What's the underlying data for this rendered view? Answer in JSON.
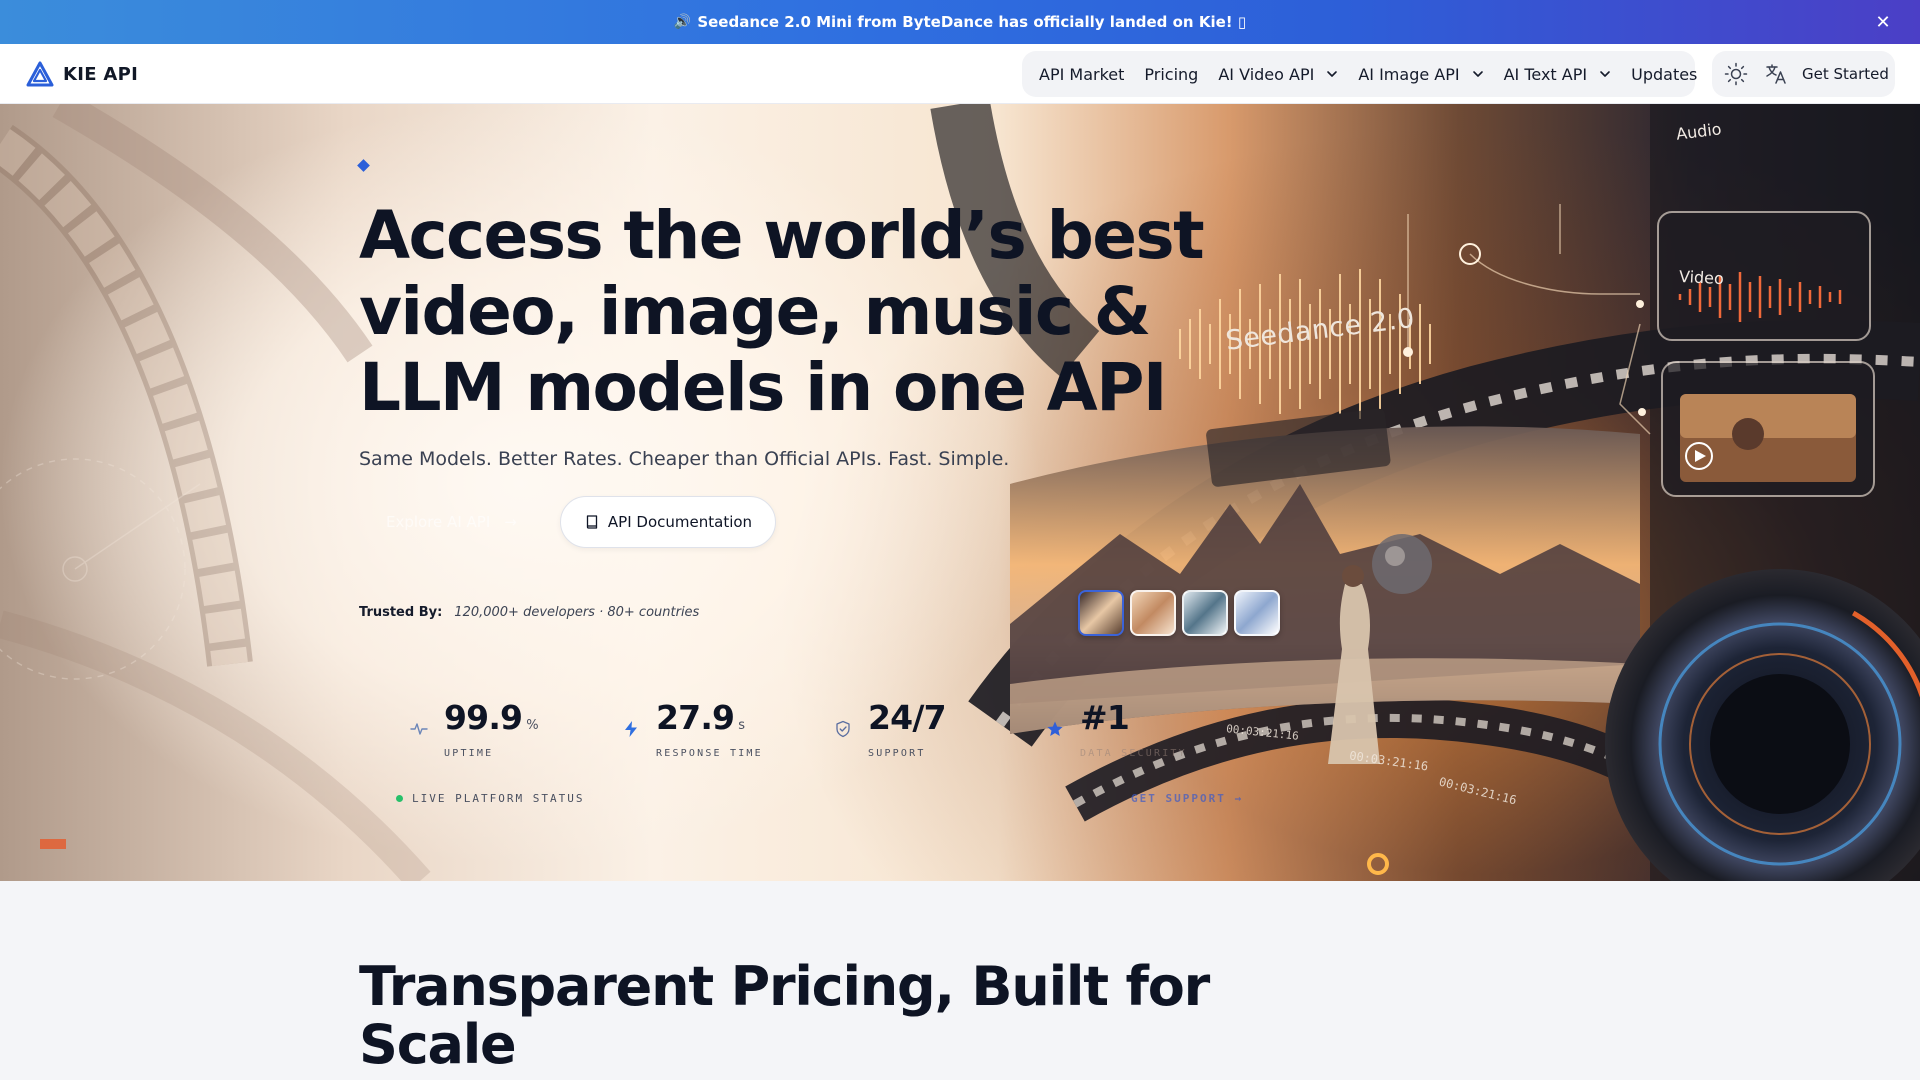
{
  "announcement": {
    "megaphone_icon": "🔊",
    "text": "Seedance 2.0 Mini from ByteDance has officially landed on Kie! ▯",
    "close_icon": "✕"
  },
  "header": {
    "brand": "KIE API",
    "nav": [
      {
        "label": "API Market",
        "dropdown": false
      },
      {
        "label": "Pricing",
        "dropdown": false
      },
      {
        "label": "AI Video API",
        "dropdown": true
      },
      {
        "label": "AI Image API",
        "dropdown": true
      },
      {
        "label": "AI Text API",
        "dropdown": true
      },
      {
        "label": "Updates",
        "dropdown": false
      }
    ],
    "theme_icon": "sun-icon",
    "language_icon": "translate-icon",
    "get_started": "Get Started"
  },
  "hero": {
    "headline": "Access the world’s best video, image, music & LLM models in one API",
    "subhead": "Same Models. Better Rates. Cheaper than Official APIs. Fast. Simple.",
    "primary_button": "Explore AI API",
    "primary_arrow": "→",
    "secondary_button": "API Documentation",
    "trusted_label": "Trusted By:",
    "trusted_value": "120,000+ developers · 80+ countries",
    "media_labels": {
      "audio": "Audio",
      "video": "Video",
      "banner": "Seedance 2.0"
    },
    "timecodes": [
      "00:03:21:16",
      "00:03:21:16",
      "00:03:21:16"
    ],
    "thumbnail_count": 4,
    "active_thumbnail": 1
  },
  "stats": [
    {
      "value": "99.9",
      "unit": "%",
      "label": "UPTIME",
      "icon": "activity-icon"
    },
    {
      "value": "27.9",
      "unit": "s",
      "label": "RESPONSE TIME",
      "icon": "lightning-icon"
    },
    {
      "value": "24/7",
      "unit": "",
      "label": "SUPPORT",
      "icon": "shield-check-icon"
    },
    {
      "value": "#1",
      "unit": "",
      "label": "DATA SECURITY",
      "icon": "star-icon"
    }
  ],
  "status": {
    "live": "LIVE PLATFORM STATUS",
    "support_link": "GET SUPPORT →"
  },
  "pricing": {
    "title": "Transparent Pricing, Built for Scale"
  },
  "colors": {
    "announce_start": "#3b8ddb",
    "announce_end": "#4b3fc6",
    "accent_blue": "#2b5fd9",
    "live_green": "#27c06a",
    "ink": "#0e1424"
  }
}
